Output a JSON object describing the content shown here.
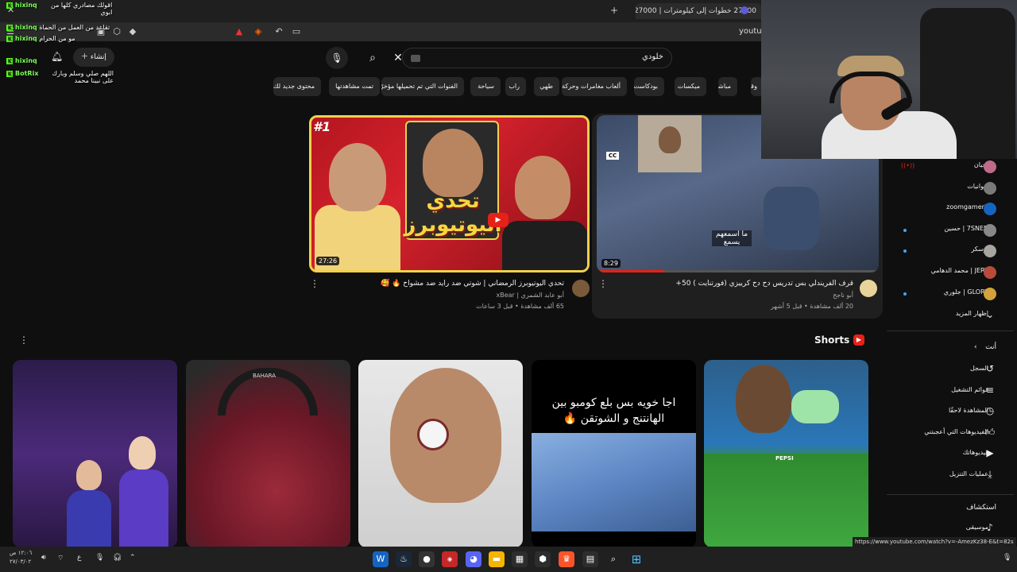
{
  "browser": {
    "active_tab_title": "27000 خطوات إلى كيلومترات | 27000",
    "new_tab_icon": "+",
    "url_text": "youtub",
    "status_url": "https://www.youtube.com/watch?v=-AmezKz38-E&t=82s"
  },
  "header": {
    "create_label": "إنشاء",
    "search_value": "خلودي",
    "search_icon": "search-icon",
    "mic_icon": "mic-icon"
  },
  "chips": [
    "محتوى جديد لك",
    "تمت مشاهدتها",
    "الفنوات التي تم تحميلها مؤخرًا",
    "سياحة",
    "راب",
    "طهي",
    "ألعاب مغامرات وحركة",
    "بودكاست",
    "ميكسات",
    "مباشر",
    "وقي"
  ],
  "videos": [
    {
      "title": "تحدي اليوتيوبرز الرمضاني | شوتي ضد رايد ضد مشواح 🔥 🥰",
      "channel": "أبو عابد الشمري | xBear",
      "meta": "65 ألف مشاهدة • قبل 3 ساعات",
      "duration": "27:26",
      "thumb_badge": "#1",
      "thumb_text": "تحدي اليوتيوبرز"
    },
    {
      "title": "قرف الفريندلي بس تدريس دح دح كرييزي (فورتنايت ) 50+",
      "channel": "أبو ناجح",
      "meta": "20 ألف مشاهدة • قبل 5 أشهر",
      "duration": "8:29",
      "thumb_caption": "ما اسمعهم يسمع",
      "cc_label": "CC"
    }
  ],
  "shorts": {
    "heading": "Shorts",
    "items": [
      {
        "caption": ""
      },
      {
        "caption": "BAHARA"
      },
      {
        "caption": ""
      },
      {
        "caption": "اجا خويه بس بلع كومبو بين الهانتنج و الشوتقن 🔥"
      },
      {
        "caption": "PEPSI"
      }
    ]
  },
  "sidebar": {
    "subscriptions": [
      {
        "name": "نحيان"
      },
      {
        "name": "ديوانيات"
      },
      {
        "name": "zoomgamer1"
      },
      {
        "name": "7SNEN | حسين"
      },
      {
        "name": "اوسكر"
      },
      {
        "name": "JERY | محمد الدهامي"
      },
      {
        "name": "GLORY | جلوري"
      }
    ],
    "show_more": "إظهار المزيد",
    "you_heading": "أنت",
    "you_items": [
      {
        "label": "السجل",
        "icon": "history-icon"
      },
      {
        "label": "قوائم التشغيل",
        "icon": "playlist-icon"
      },
      {
        "label": "المشاهدة لاحقًا",
        "icon": "clock-icon"
      },
      {
        "label": "الفيديوهات التي أعجبتني",
        "icon": "thumbs-up-icon"
      },
      {
        "label": "فيديوهاتك",
        "icon": "play-square-icon"
      },
      {
        "label": "عمليات التنزيل",
        "icon": "download-icon"
      }
    ],
    "explore_heading": "استكشاف",
    "explore_items": [
      {
        "label": "موسيقى",
        "icon": "music-icon"
      }
    ]
  },
  "chat": [
    {
      "user": "hixinq",
      "text": "اقولك مصادري كلها من ابوي"
    },
    {
      "user": "hixinq",
      "text": "تقاعد من العمل من الحماة"
    },
    {
      "user": "hixinq",
      "text": "مو من الحرام"
    },
    {
      "user": "hixinq",
      "text": ""
    },
    {
      "user": "BotRix",
      "text": "اللهم صلي وسلم وبارك على نبينا محمد"
    }
  ],
  "taskbar": {
    "clock_time": "١٢:٠٦ ص",
    "clock_date": "٢٧/٠٣/٠٢",
    "lang": "ع"
  },
  "colors": {
    "background": "#0f0f0f",
    "accent_red": "#e62117",
    "kick_green": "#53fc18"
  }
}
